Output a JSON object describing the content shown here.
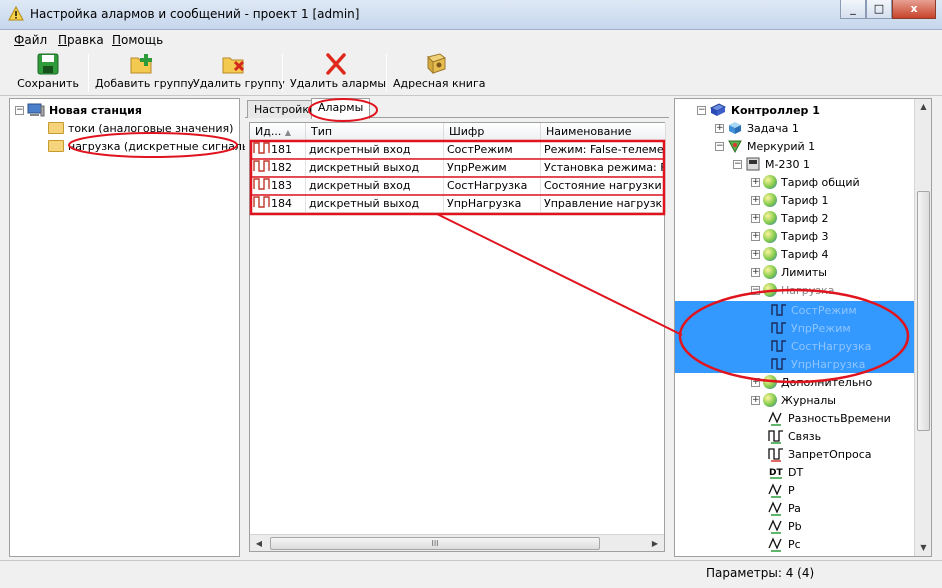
{
  "window": {
    "title": "Настройка алармов и сообщений - проект 1 [admin]",
    "controls": [
      "_",
      "□",
      "x"
    ]
  },
  "menu": [
    {
      "underline": "Ф",
      "rest": "айл"
    },
    {
      "underline": "П",
      "rest": "равка"
    },
    {
      "underline": "П",
      "rest": "омощь"
    }
  ],
  "toolbar": {
    "save": "Сохранить",
    "add_group": "Добавить группу",
    "delete_group": "Удалить группу",
    "delete_alarms": "Удалить алармы",
    "address_book": "Адресная книга"
  },
  "left_tree": {
    "root": "Новая станция",
    "items": [
      "токи (аналоговые значения)",
      "нагрузка (дискретные сигналы)"
    ]
  },
  "tabs": [
    "Настройки",
    "Алармы"
  ],
  "grid": {
    "columns": [
      "Ид...",
      "Тип",
      "Шифр",
      "Наименование"
    ],
    "rows": [
      {
        "id": "181",
        "type": "дискретный вход",
        "code": "СостРежим",
        "name": "Режим: False-телеметр"
      },
      {
        "id": "182",
        "type": "дискретный выход",
        "code": "УпрРежим",
        "name": "Установка режима: Fa"
      },
      {
        "id": "183",
        "type": "дискретный вход",
        "code": "СостНагрузка",
        "name": "Состояние нагрузки: F"
      },
      {
        "id": "184",
        "type": "дискретный выход",
        "code": "УпрНагрузка",
        "name": "Управление нагрузкой"
      }
    ],
    "scroll_mark": "III"
  },
  "right_tree": {
    "controller": "Контроллер 1",
    "task": "Задача 1",
    "mercury": "Меркурий 1",
    "meter": "М-230 1",
    "tariffs": [
      "Тариф общий",
      "Тариф 1",
      "Тариф 2",
      "Тариф 3",
      "Тариф 4",
      "Лимиты"
    ],
    "load": "Нагрузка",
    "load_children": [
      "СостРежим",
      "УпрРежим",
      "СостНагрузка",
      "УпрНагрузка"
    ],
    "after": [
      "Дополнительно",
      "Журналы"
    ],
    "signals": [
      "РазностьВремени",
      "Связь",
      "ЗапретОпроса",
      "DT",
      "P",
      "Pa",
      "Pb",
      "Pc"
    ]
  },
  "status": {
    "text": "Параметры: 4 (4)"
  },
  "colors": {
    "selection": "#3399ff",
    "annotation": "#e0141e"
  }
}
